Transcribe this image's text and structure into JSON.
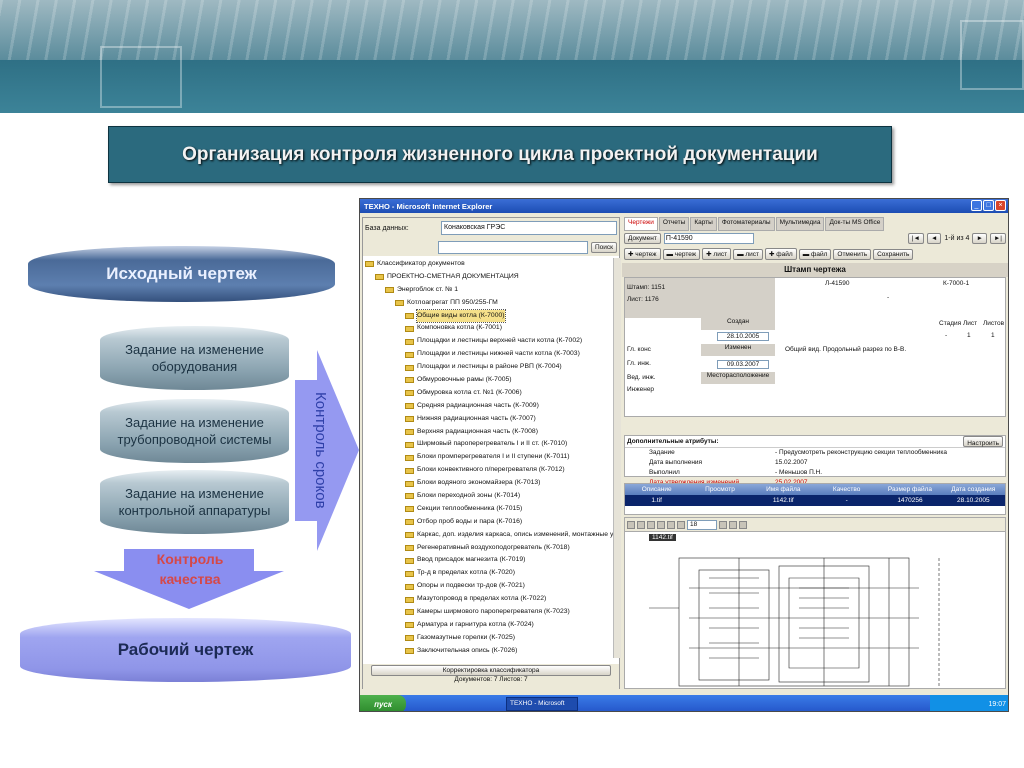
{
  "slide": {
    "title": "Организация контроля жизненного  цикла проектной документации",
    "source_drawing": "Исходный чертеж",
    "tasks": [
      "Задание на изменение оборудования",
      "Задание на изменение трубопроводной системы",
      "Задание на изменение контрольной аппаратуры"
    ],
    "control_terms": "Контроль сроков",
    "control_quality": "Контроль качества",
    "working_drawing": "Рабочий чертеж"
  },
  "window": {
    "title": "ТЕХНО - Microsoft Internet Explorer",
    "db_label": "База данных:",
    "db_value": "Конаковская ГРЭС",
    "search_button": "Поиск",
    "tree": [
      {
        "label": "Классификатор документов",
        "level": 0
      },
      {
        "label": "ПРОЕКТНО-СМЕТНАЯ ДОКУМЕНТАЦИЯ",
        "level": 1
      },
      {
        "label": "Энергоблок ст. № 1",
        "level": 2
      },
      {
        "label": "Котлоагрегат ПП 950/255-ГМ",
        "level": 3
      },
      {
        "label": "Общие виды котла (К-7000)",
        "level": 4,
        "selected": true
      },
      {
        "label": "Компоновка котла (К-7001)",
        "level": 4
      },
      {
        "label": "Площадки и лестницы верхней части котла (К-7002)",
        "level": 4
      },
      {
        "label": "Площадки и лестницы нижней части котла (К-7003)",
        "level": 4
      },
      {
        "label": "Площадки и лестницы в районе РВП (К-7004)",
        "level": 4
      },
      {
        "label": "Обмуровочные рамы (К-7005)",
        "level": 4
      },
      {
        "label": "Обмуровка котла ст. №1 (К-7006)",
        "level": 4
      },
      {
        "label": "Средняя радиационная часть (К-7009)",
        "level": 4
      },
      {
        "label": "Нижняя радиационная часть (К-7007)",
        "level": 4
      },
      {
        "label": "Верхняя радиационная часть (К-7008)",
        "level": 4
      },
      {
        "label": "Ширмовый пароперегреватель I и II ст. (К-7010)",
        "level": 4
      },
      {
        "label": "Блоки промперегревателя I и II ступени (К-7011)",
        "level": 4
      },
      {
        "label": "Блоки конвективного п/перегревателя (К-7012)",
        "level": 4
      },
      {
        "label": "Блоки водяного экономайзера (К-7013)",
        "level": 4
      },
      {
        "label": "Блоки переходной зоны (К-7014)",
        "level": 4
      },
      {
        "label": "Секции теплообменника (К-7015)",
        "level": 4
      },
      {
        "label": "Отбор проб воды и пара (К-7016)",
        "level": 4
      },
      {
        "label": "Каркас, доп. изделия каркаса, опись изменений, монтажные у",
        "level": 4
      },
      {
        "label": "Регенеративный воздухоподогреватель (К-7018)",
        "level": 4
      },
      {
        "label": "Ввод присадок магнезита (К-7019)",
        "level": 4
      },
      {
        "label": "Тр-д в пределах котла (К-7020)",
        "level": 4
      },
      {
        "label": "Опоры и подвески тр-дов (К-7021)",
        "level": 4
      },
      {
        "label": "Мазутопровод в пределах котла (К-7022)",
        "level": 4
      },
      {
        "label": "Камеры ширмового пароперегревателя (К-7023)",
        "level": 4
      },
      {
        "label": "Арматура и гарнитура котла (К-7024)",
        "level": 4
      },
      {
        "label": "Газомазутные горелки (К-7025)",
        "level": 4
      },
      {
        "label": "Заключительная опись (К-7026)",
        "level": 4
      }
    ],
    "classifier_button": "Корректировка классификатора",
    "doc_status": "Документов: 7    Листов: 7",
    "tabs": [
      "Чертежи",
      "Отчеты",
      "Карты",
      "Фотоматериалы",
      "Мультимедиа",
      "Док-ты MS Office"
    ],
    "doc_label": "Документ",
    "doc_value": "П-41590",
    "page_of": "1-й из 4",
    "toolbar": [
      "чертеж",
      "чертеж",
      "лист",
      "лист",
      "файл",
      "файл"
    ],
    "cancel_button": "Отменить",
    "save_button": "Сохранить",
    "stamp_title": "Штамп чертежа",
    "stamp": {
      "stamp_no": "Штамп: 1151",
      "sheet": "Лист: 1176",
      "code1": "Л-41590",
      "code2": "К-7000-1",
      "created_label": "Создан",
      "created_date": "28.10.2005",
      "stage": "Стадия",
      "sheet_lbl": "Лист",
      "sheets_lbl": "Листов",
      "stage_val": "-",
      "sheet_val": "1",
      "sheets_val": "1",
      "gl_kons": "Гл. конс",
      "changed": "Изменен",
      "gl_ing": "Гл. инж.",
      "changed_date": "09.03.2007",
      "ved_ing": "Вед. инж.",
      "location": "Месторасположение",
      "engineer": "Инженер",
      "desc": "Общий вид. Продольный разрез по В-В.",
      "dash": "-"
    },
    "attrs_title": "Дополнительные атрибуты:",
    "attrs_button": "Настроить",
    "attrs": [
      {
        "k": "Задание",
        "v": "- Предусмотреть реконструкцию секции теплообменника"
      },
      {
        "k": "Дата выполнения",
        "v": "15.02.2007"
      },
      {
        "k": "Выполнил",
        "v": "- Меньшов П.Н."
      },
      {
        "k": "Дата утверждения изменений",
        "v": "25.02.2007",
        "red": true
      }
    ],
    "files_header": [
      "Описание",
      "Просмотр",
      "Имя файла",
      "Качество",
      "Размер файла",
      "Дата создания"
    ],
    "files_row": [
      "1.tif",
      "",
      "1142.tif",
      "-",
      "1470256",
      "28.10.2005"
    ],
    "viewer_zoom": "18",
    "viewer_file": "1142.tif",
    "taskbar_start": "пуск",
    "taskbar_app": "ТЕХНО - Microsoft Inter...",
    "clock": "19:07"
  }
}
